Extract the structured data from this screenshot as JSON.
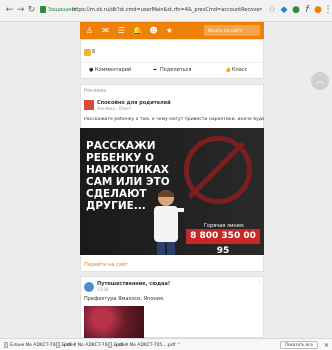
{
  "browser": {
    "secure_label": "Защищено",
    "url": "https://m.ok.ru/dk?st.cmd=userMain&st.rfn=4&_prevCmd=accountRecoverChangePassword",
    "back_icon": "back-arrow-icon",
    "forward_icon": "forward-arrow-icon",
    "reload_icon": "reload-icon"
  },
  "ok_header": {
    "search_placeholder": "Искать на сайте"
  },
  "post_actions": {
    "count": "8",
    "comment": "Комментарий",
    "share": "Поделиться",
    "klass": "Класс"
  },
  "ad_post": {
    "section": "Реклама",
    "author": "Спокойно для родителей",
    "sub": "Реклама · Ответ",
    "text": "Расскажите ребенку о том, к чему могут привести наркотики, иначе будет поздно.",
    "headline": "РАССКАЖИ РЕБЕНКУ О НАРКОТИКАХ САМ ИЛИ ЭТО СДЕЛАЮТ ДРУГИЕ...",
    "hotline_label": "Горячая линия:",
    "phone": "8 800 350 00 95",
    "go_to_site": "Перейти на сайт"
  },
  "travel_post": {
    "author": "Путешественник, сюдаа!",
    "time": "15:04",
    "text": "Префектура Ямахоси, Япония."
  },
  "downloads": {
    "items": [
      {
        "name": "Бланк No ADKCT-704....pdf"
      },
      {
        "name": "Бланк No ADKCT-704....pdf"
      },
      {
        "name": "Бланк No ADKCT-705....pdf"
      }
    ],
    "show_all": "Показать все"
  },
  "colors": {
    "ok_orange": "#ee8208",
    "hotline_red": "#c62828"
  }
}
